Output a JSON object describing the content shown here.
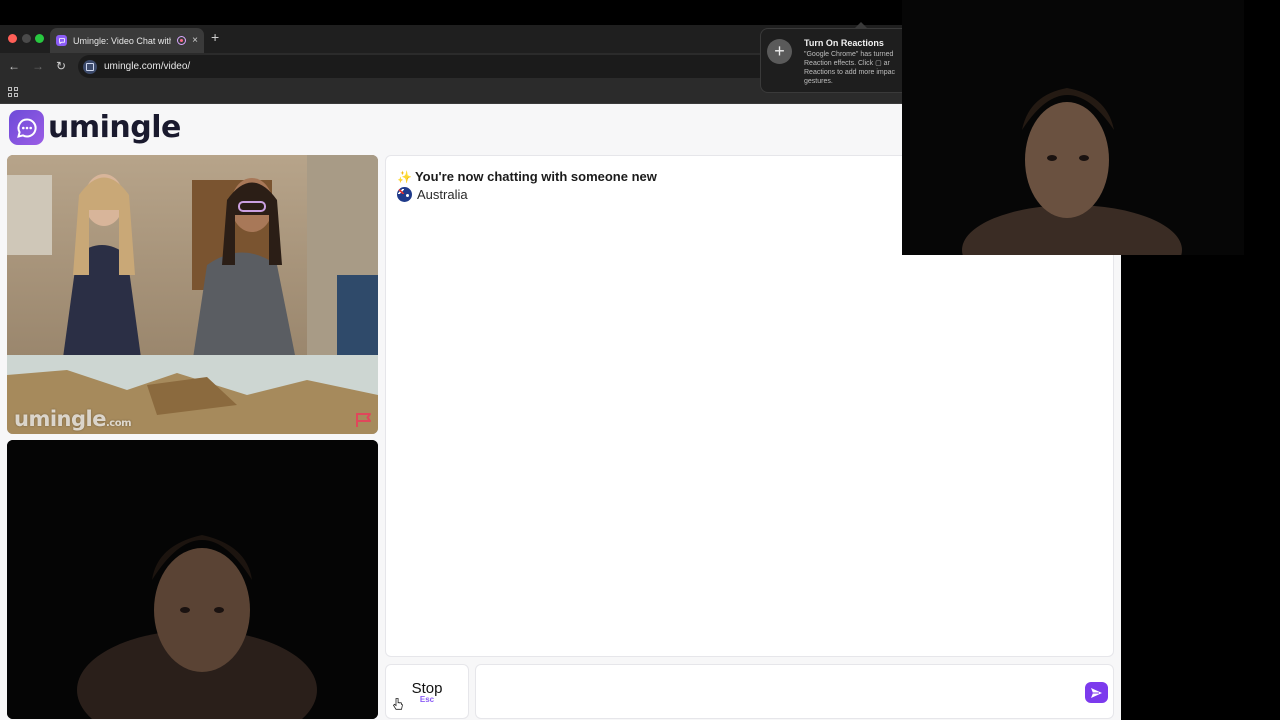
{
  "browser": {
    "tab_title": "Umingle: Video Chat with",
    "new_tab": "+",
    "tab_close": "×",
    "url": "umingle.com/video/",
    "nav_back": "←",
    "nav_forward": "→",
    "nav_reload": "↻"
  },
  "notification": {
    "title": "Turn On Reactions",
    "body": "\"Google Chrome\" has turned\nReaction effects. Click ▢ ar\nReactions to add more impac\ngestures.",
    "icon": "+"
  },
  "site": {
    "logo_text": "umingle",
    "watermark": "umingle",
    "watermark_suffix": ".com"
  },
  "chat": {
    "sparkle": "✨",
    "status": "You're now chatting with someone new",
    "country": "Australia"
  },
  "controls": {
    "stop_label": "Stop",
    "stop_hint": "Esc",
    "message_placeholder": ""
  },
  "colors": {
    "brand": "#7c3aed",
    "report_flag": "#e0475b"
  }
}
